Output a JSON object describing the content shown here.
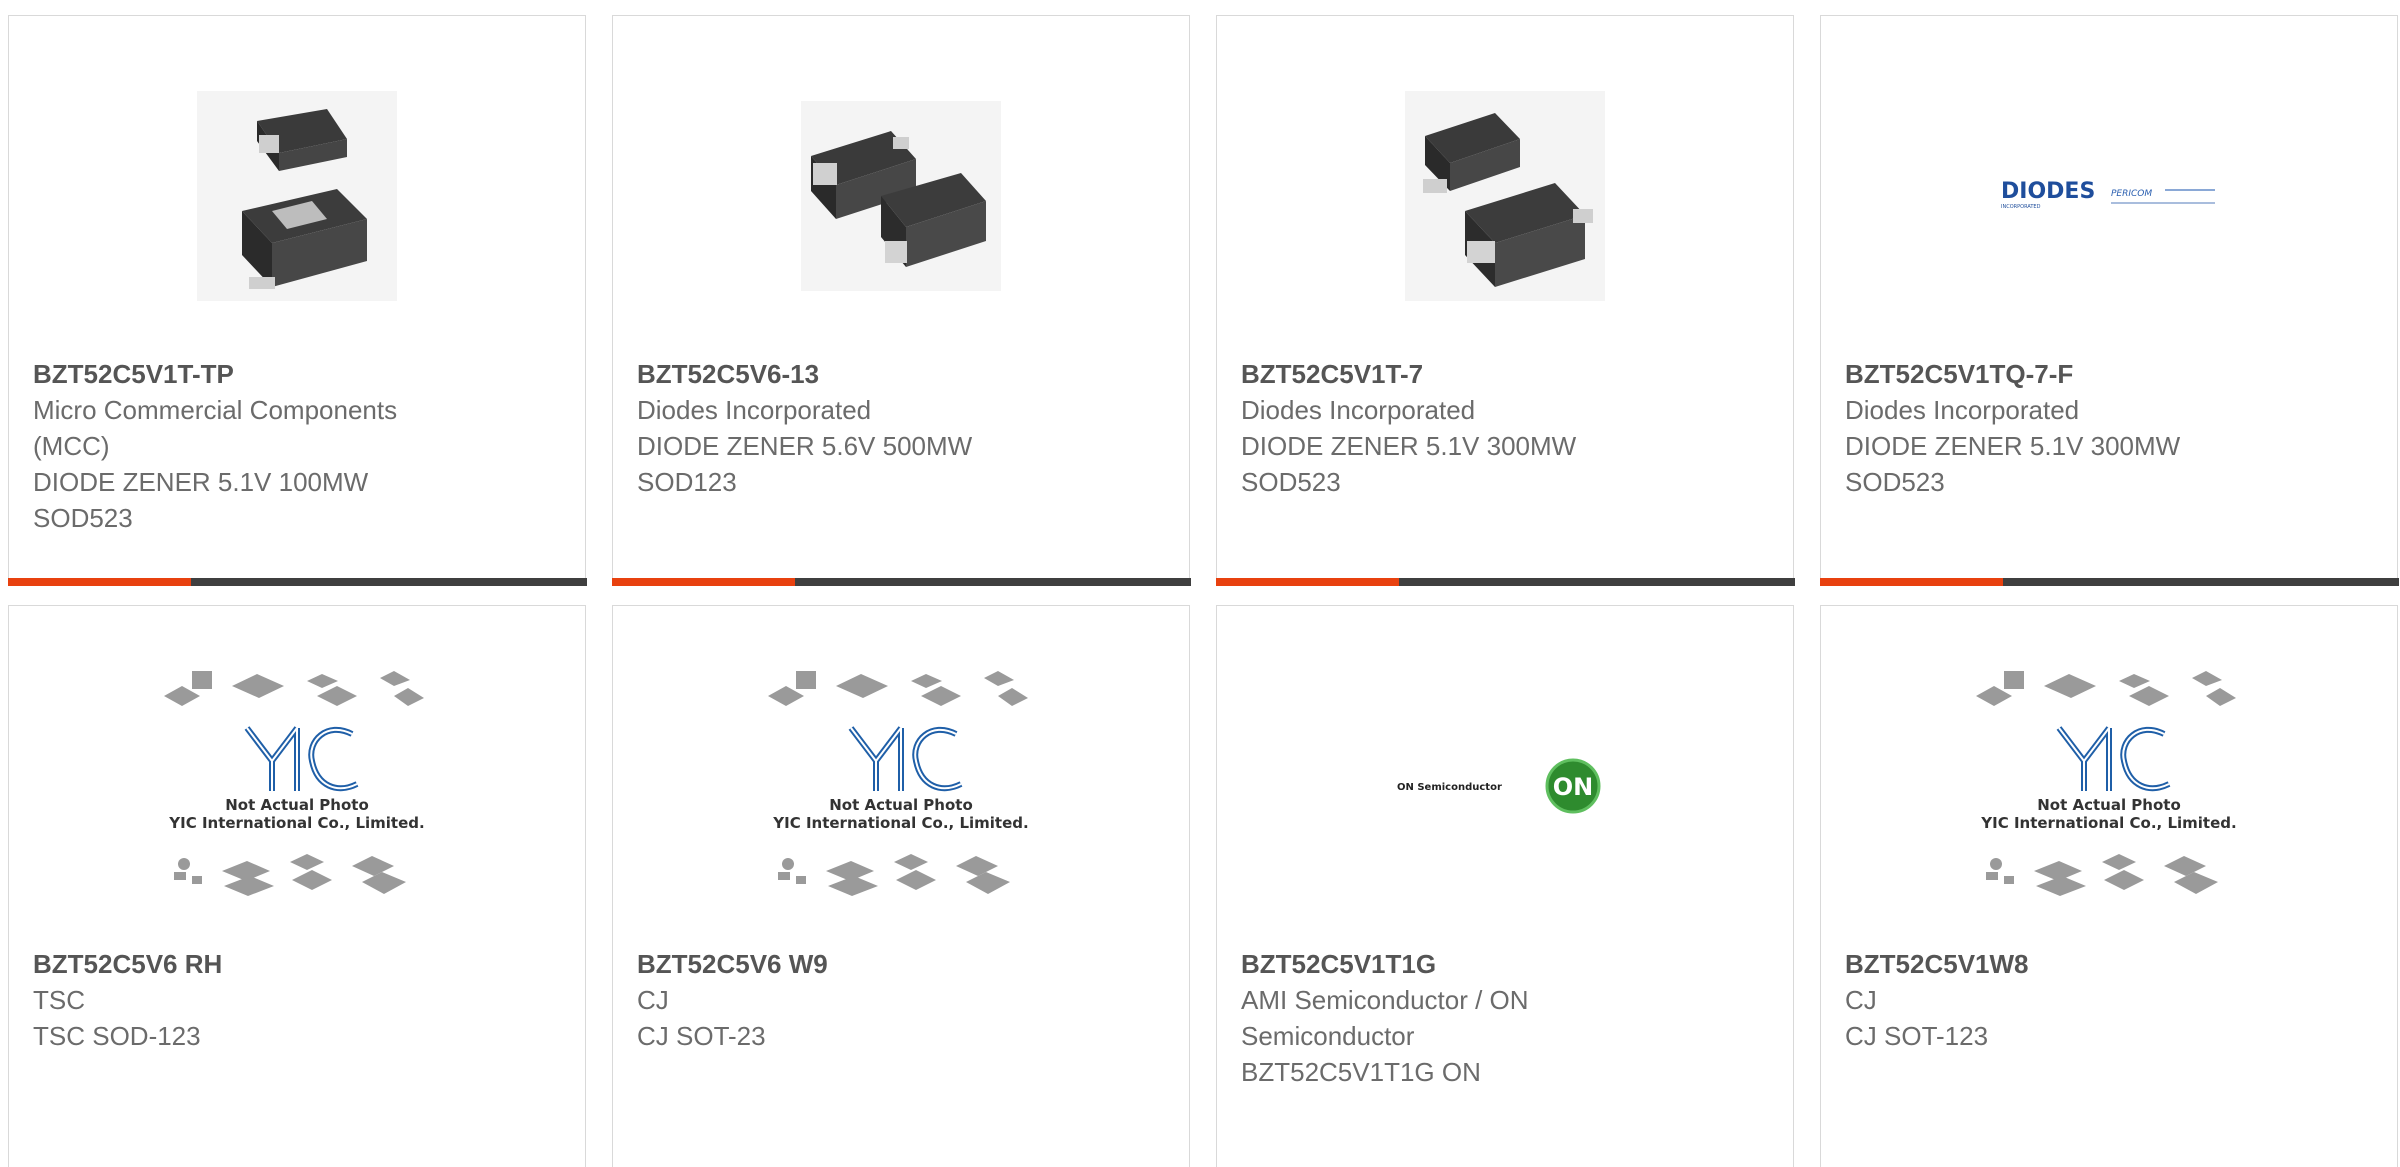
{
  "cards": [
    {
      "part": "BZT52C5V1T-TP",
      "lines": [
        "Micro Commercial Components",
        "(MCC)",
        "DIODE ZENER 5.1V 100MW",
        "SOD523"
      ],
      "image": "sod523-package-image",
      "has_bar": true
    },
    {
      "part": "BZT52C5V6-13",
      "lines": [
        "Diodes Incorporated",
        "DIODE ZENER 5.6V 500MW",
        "SOD123"
      ],
      "image": "sod123-package-image",
      "has_bar": true
    },
    {
      "part": "BZT52C5V1T-7",
      "lines": [
        "Diodes Incorporated",
        "DIODE ZENER 5.1V 300MW",
        "SOD523"
      ],
      "image": "sod523-package-image",
      "has_bar": true
    },
    {
      "part": "BZT52C5V1TQ-7-F",
      "lines": [
        "Diodes Incorporated",
        "DIODE ZENER 5.1V 300MW",
        "SOD523"
      ],
      "image": "diodes-pericom-logo",
      "has_bar": true
    },
    {
      "part": "BZT52C5V6 RH",
      "lines": [
        "TSC",
        "TSC SOD-123"
      ],
      "image": "not-actual-photo-placeholder",
      "has_bar": false
    },
    {
      "part": "BZT52C5V6 W9",
      "lines": [
        "CJ",
        "CJ SOT-23"
      ],
      "image": "not-actual-photo-placeholder",
      "has_bar": false
    },
    {
      "part": "BZT52C5V1T1G",
      "lines": [
        "AMI Semiconductor / ON",
        "Semiconductor",
        "BZT52C5V1T1G ON"
      ],
      "image": "on-semiconductor-logo",
      "has_bar": false
    },
    {
      "part": "BZT52C5V1W8",
      "lines": [
        "CJ",
        "CJ SOT-123"
      ],
      "image": "not-actual-photo-placeholder",
      "has_bar": false
    }
  ],
  "placeholder": {
    "line1": "Not Actual Photo",
    "line2": "YIC International Co., Limited.",
    "logo": "YIC"
  },
  "logos": {
    "diodes": "DIODES",
    "diodes_sub": "INCORPORATED",
    "pericom": "PERICOM",
    "on_semi": "ON Semiconductor",
    "on_badge": "ON"
  },
  "colors": {
    "accent": "#e8410f",
    "bar_dark": "#3f3f3f",
    "text": "#6b6b6b",
    "part": "#555555",
    "border": "#d9d9d9",
    "on_green": "#2e8b2e",
    "diodes_blue": "#1f4e9c"
  }
}
